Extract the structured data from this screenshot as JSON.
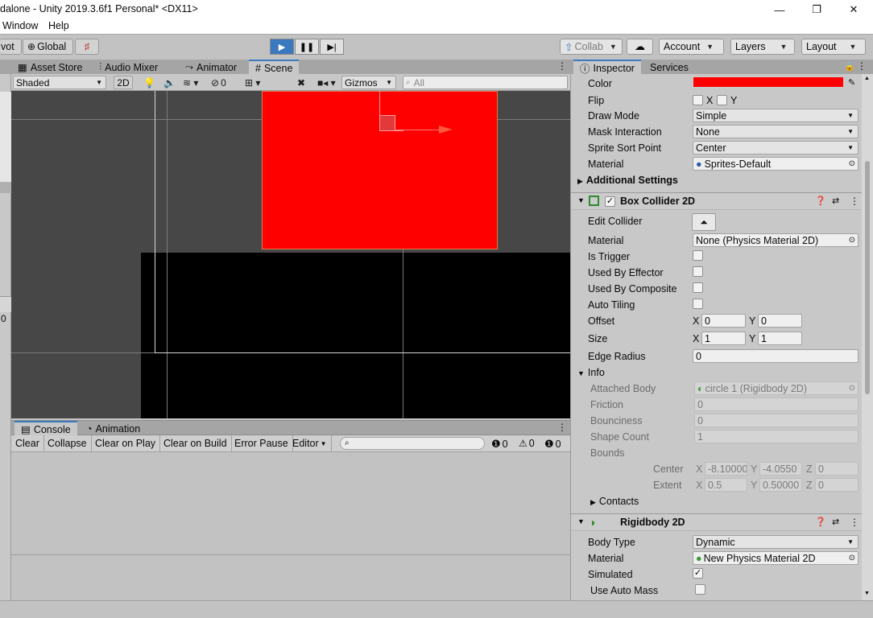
{
  "window": {
    "title": "dalone - Unity 2019.3.6f1 Personal* <DX11>",
    "minimize": "—",
    "maximize": "❐",
    "close": "✕"
  },
  "menu": [
    "Window",
    "Help"
  ],
  "toolbar": {
    "pivot": "vot",
    "global": "Global",
    "collab": "Collab",
    "account": "Account",
    "layers": "Layers",
    "layout": "Layout"
  },
  "tabs": {
    "scene_tabs": [
      "Asset Store",
      "Audio Mixer",
      "Animator",
      "Scene"
    ],
    "inspector_tabs": [
      "Inspector",
      "Services"
    ],
    "console_tabs": [
      "Console",
      "Animation"
    ]
  },
  "scene_toolbar": {
    "shading": "Shaded",
    "mode_2d": "2D",
    "hidden_count": "0",
    "gizmos": "Gizmos",
    "search_placeholder": "All"
  },
  "left_strip": {
    "value": "0"
  },
  "console": {
    "buttons": [
      "Clear",
      "Collapse",
      "Clear on Play",
      "Clear on Build",
      "Error Pause",
      "Editor"
    ],
    "info_count": "0",
    "warning_count": "0",
    "error_count": "0"
  },
  "inspector": {
    "sprite": {
      "color_label": "Color",
      "color_value": "#ff0000",
      "flip_label": "Flip",
      "flip_x": "X",
      "flip_y": "Y",
      "draw_mode_label": "Draw Mode",
      "draw_mode": "Simple",
      "mask_label": "Mask Interaction",
      "mask": "None",
      "sort_label": "Sprite Sort Point",
      "sort": "Center",
      "material_label": "Material",
      "material": "Sprites-Default",
      "additional": "Additional Settings"
    },
    "box_collider": {
      "title": "Box Collider 2D",
      "edit_collider": "Edit Collider",
      "material_label": "Material",
      "material": "None (Physics Material 2D)",
      "is_trigger": "Is Trigger",
      "used_by_effector": "Used By Effector",
      "used_by_composite": "Used By Composite",
      "auto_tiling": "Auto Tiling",
      "offset_label": "Offset",
      "offset_x": "0",
      "offset_y": "0",
      "size_label": "Size",
      "size_x": "1",
      "size_y": "1",
      "edge_radius_label": "Edge Radius",
      "edge_radius": "0",
      "info": "Info",
      "attached_body_label": "Attached Body",
      "attached_body": "circle 1 (Rigidbody 2D)",
      "friction_label": "Friction",
      "friction": "0",
      "bounciness_label": "Bounciness",
      "bounciness": "0",
      "shape_count_label": "Shape Count",
      "shape_count": "1",
      "bounds_label": "Bounds",
      "center_label": "Center",
      "center_x": "-8.10000",
      "center_y": "-4.0550",
      "center_z": "0",
      "extent_label": "Extent",
      "extent_x": "0.5",
      "extent_y": "0.50000",
      "extent_z": "0",
      "contacts": "Contacts"
    },
    "rigidbody": {
      "title": "Rigidbody 2D",
      "body_type_label": "Body Type",
      "body_type": "Dynamic",
      "material_label": "Material",
      "material": "New Physics Material 2D",
      "simulated_label": "Simulated",
      "auto_mass_label": "Use Auto Mass"
    },
    "axis": {
      "x": "X",
      "y": "Y",
      "z": "Z"
    }
  },
  "colors": {
    "sprite_red": "#ff0000",
    "scene_bg": "#474747",
    "accent": "#3a79bd"
  }
}
